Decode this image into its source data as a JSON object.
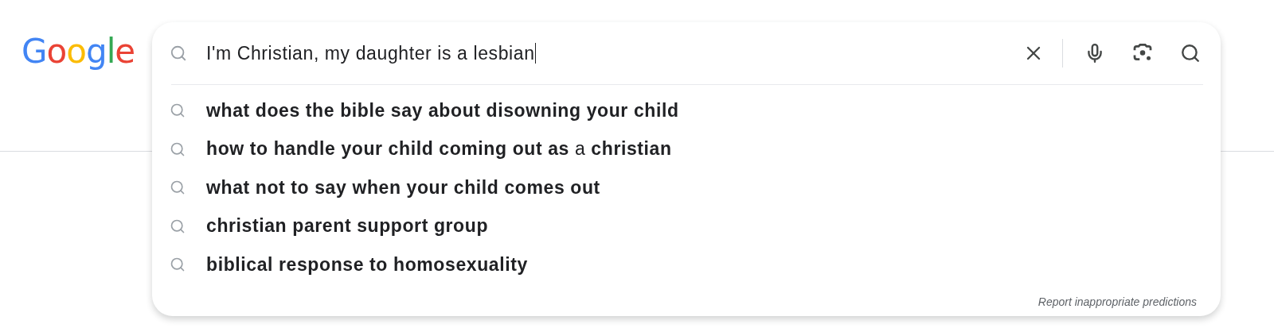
{
  "logo": "Google",
  "search": {
    "value": "I'm Christian, my daughter is a lesbian"
  },
  "suggestions": [
    {
      "text": "**what does the bible say about disowning your child**"
    },
    {
      "text": "**how to handle your child coming out as** a **christian**"
    },
    {
      "text": "**what not to say when your child comes out**"
    },
    {
      "text": "**christian parent support group**"
    },
    {
      "text": "**biblical response to homosexuality**"
    }
  ],
  "report_link": "Report inappropriate predictions"
}
